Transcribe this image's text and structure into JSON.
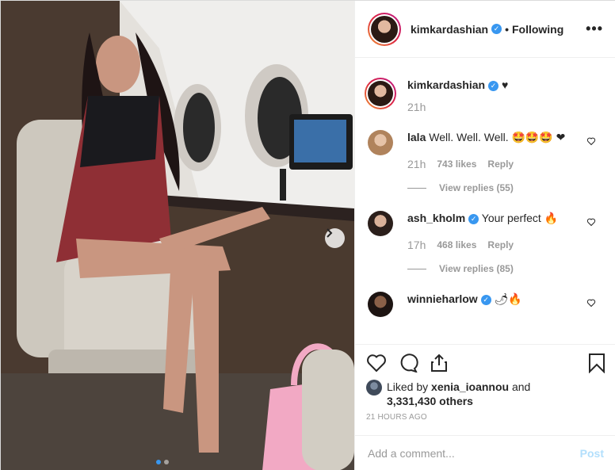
{
  "post": {
    "author": "kimkardashian",
    "follow_state": "Following",
    "separator": "•",
    "more_icon": "more-horizontal-icon",
    "more_glyph": "•••"
  },
  "caption": {
    "user": "kimkardashian",
    "text": "♥",
    "time": "21h"
  },
  "comments": [
    {
      "user": "lala",
      "text": "Well. Well. Well. 🤩🤩🤩 ❤",
      "time": "21h",
      "likes": "743 likes",
      "reply": "Reply",
      "view_replies": "View replies (55)"
    },
    {
      "user": "ash_kholm",
      "text": "Your perfect 🔥",
      "time": "17h",
      "likes": "468 likes",
      "reply": "Reply",
      "view_replies": "View replies (85)"
    },
    {
      "user": "winnieharlow",
      "text": "🌶🔥"
    }
  ],
  "liked_by": {
    "prefix": "Liked by",
    "user": "xenia_ioannou",
    "connector": "and",
    "others": "3,331,430 others"
  },
  "timestamp": "21 HOURS AGO",
  "comment_box": {
    "placeholder": "Add a comment...",
    "post_label": "Post"
  },
  "carousel": {
    "current": 1,
    "total": 2
  },
  "colors": {
    "verified": "#3897f0",
    "post_disabled": "#b2dffc",
    "muted": "#999999"
  }
}
